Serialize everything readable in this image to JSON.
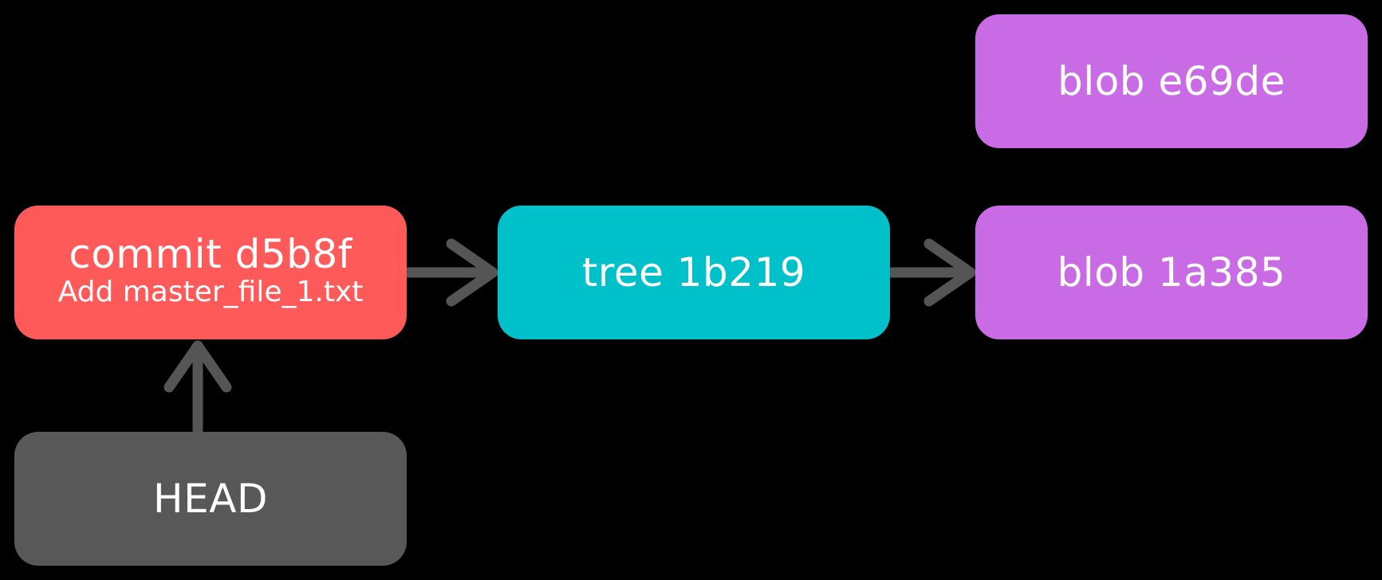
{
  "nodes": {
    "commit": {
      "title": "commit d5b8f",
      "message": "Add master_file_1.txt",
      "color": "#ff5a5a"
    },
    "tree": {
      "title": "tree 1b219",
      "color": "#00c1ca"
    },
    "blob_top": {
      "title": "blob e69de",
      "color": "#c86be4"
    },
    "blob_bottom": {
      "title": "blob 1a385",
      "color": "#c86be4"
    },
    "head": {
      "title": "HEAD",
      "color": "#585858"
    }
  },
  "edges": [
    {
      "from": "commit",
      "to": "tree"
    },
    {
      "from": "tree",
      "to": "blob_bottom"
    },
    {
      "from": "head",
      "to": "commit"
    }
  ],
  "style": {
    "background": "#000000",
    "arrow_color": "#555555",
    "text_color": "#ffffff"
  }
}
